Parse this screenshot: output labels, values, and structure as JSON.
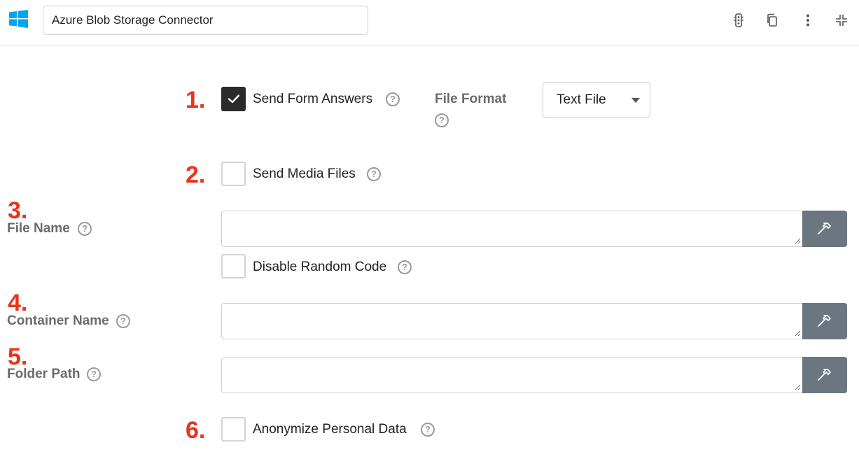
{
  "header": {
    "logo_icon": "windows-logo-icon",
    "title_value": "Azure Blob Storage Connector",
    "icons": [
      "traffic-light-icon",
      "copy-icon",
      "more-vertical-icon",
      "collapse-icon"
    ]
  },
  "form": {
    "send_form_answers": {
      "number": "1.",
      "label": "Send Form Answers",
      "checked": true
    },
    "file_format": {
      "label": "File Format",
      "selected": "Text File"
    },
    "send_media_files": {
      "number": "2.",
      "label": "Send Media Files",
      "checked": false
    },
    "file_name": {
      "number": "3.",
      "label": "File Name",
      "value": ""
    },
    "disable_random_code": {
      "label": "Disable Random Code",
      "checked": false
    },
    "container_name": {
      "number": "4.",
      "label": "Container Name",
      "value": ""
    },
    "folder_path": {
      "number": "5.",
      "label": "Folder Path",
      "value": ""
    },
    "anonymize_personal_data": {
      "number": "6.",
      "label": "Anonymize Personal Data",
      "checked": false
    },
    "help_glyph": "?"
  },
  "colors": {
    "annotation_number": "#e8341c",
    "logo_blue": "#00a4ef",
    "hammer_button_bg": "#6b7680",
    "checkbox_checked_bg": "#2b2b2b"
  }
}
